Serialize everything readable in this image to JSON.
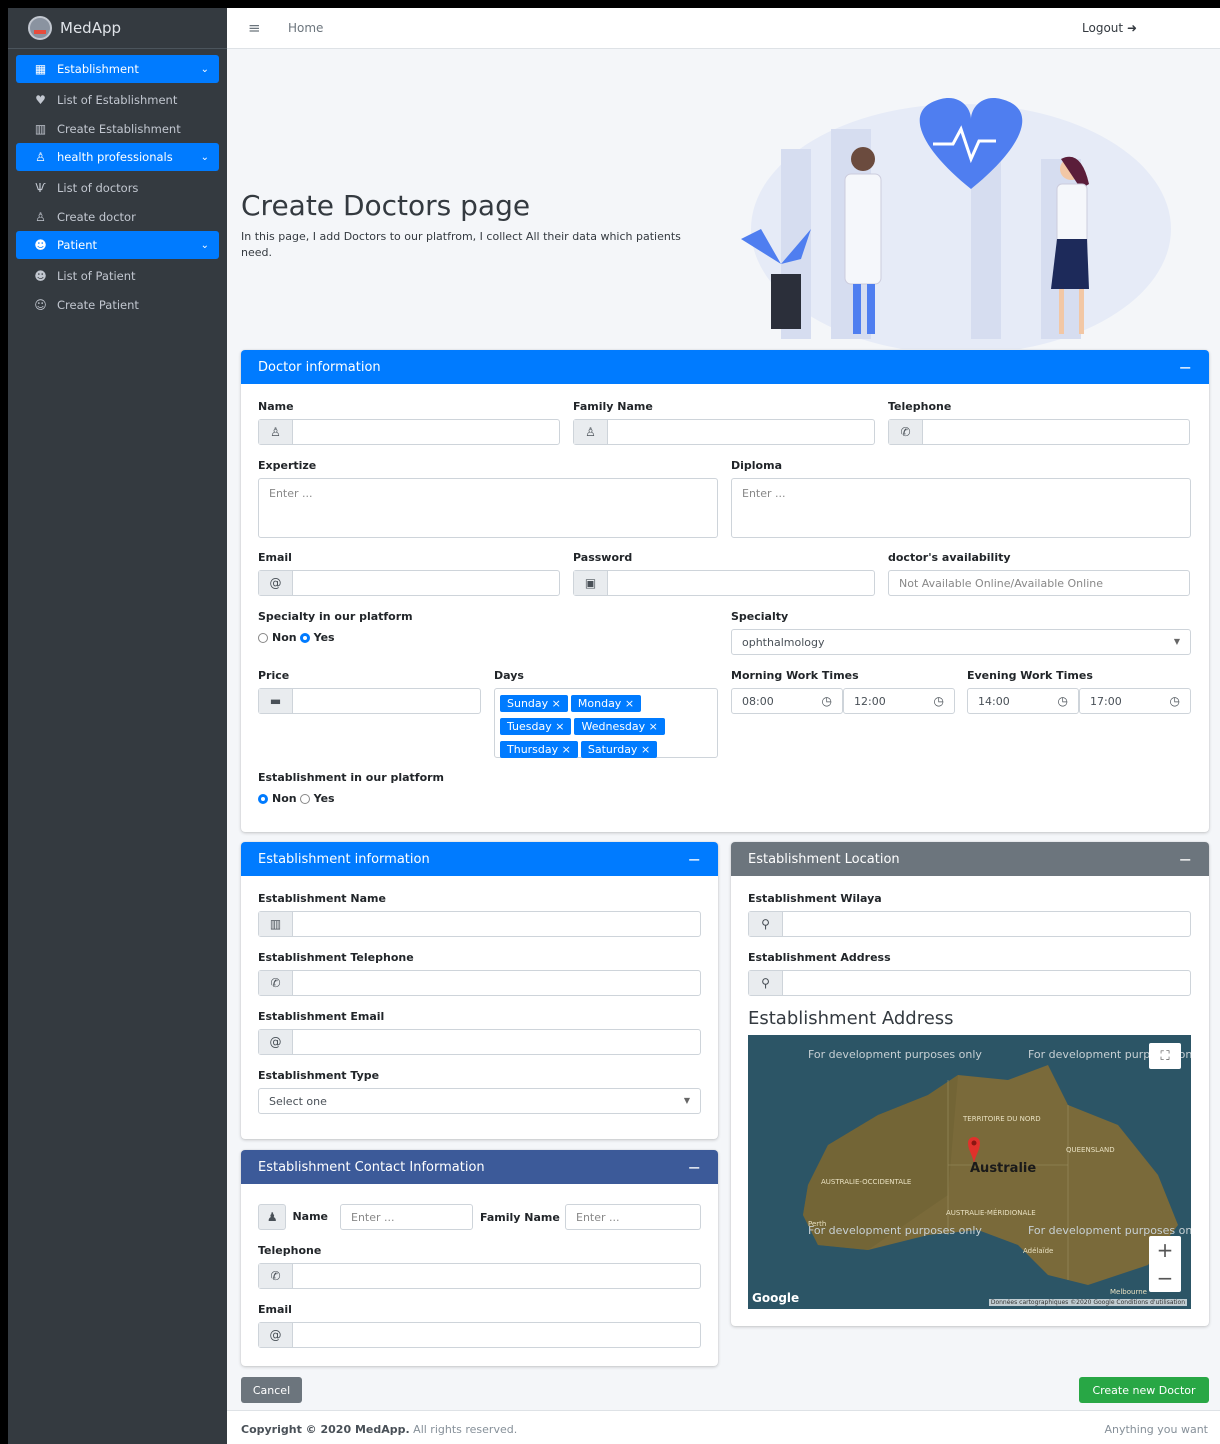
{
  "brand": {
    "name": "MedApp"
  },
  "sidebar": {
    "sections": [
      {
        "title": "Establishment",
        "icon": "hospital-icon",
        "items": [
          {
            "label": "List of Establishment",
            "icon": "heartbeat-icon"
          },
          {
            "label": "Create Establishment",
            "icon": "building-icon"
          }
        ]
      },
      {
        "title": "health professionals",
        "icon": "user-doctor-icon",
        "items": [
          {
            "label": "List of doctors",
            "icon": "stethoscope-icon"
          },
          {
            "label": "Create doctor",
            "icon": "user-doctor-icon"
          }
        ]
      },
      {
        "title": "Patient",
        "icon": "users-icon",
        "items": [
          {
            "label": "List of Patient",
            "icon": "users-icon"
          },
          {
            "label": "Create Patient",
            "icon": "user-plus-icon"
          }
        ]
      }
    ]
  },
  "topbar": {
    "home": "Home",
    "logout": "Logout"
  },
  "hero": {
    "title": "Create Doctors page",
    "subtitle": "In this page, I add Doctors to our platfrom, I collect All their data which patients need."
  },
  "doctor": {
    "header": "Doctor information",
    "name_label": "Name",
    "family_label": "Family Name",
    "telephone_label": "Telephone",
    "expertize_label": "Expertize",
    "expertize_placeholder": "Enter ...",
    "diploma_label": "Diploma",
    "diploma_placeholder": "Enter ...",
    "email_label": "Email",
    "password_label": "Password",
    "availability_label": "doctor's availability",
    "availability_placeholder": "Not Available Online/Available Online",
    "specialty_platform_label": "Specialty in our platform",
    "non": "Non",
    "yes": "Yes",
    "specialty_label": "Specialty",
    "specialty_value": "ophthalmology",
    "price_label": "Price",
    "days_label": "Days",
    "days": [
      "Sunday",
      "Monday",
      "Tuesday",
      "Wednesday",
      "Thursday",
      "Saturday"
    ],
    "morning_label": "Morning Work Times",
    "morning_start": "08:00",
    "morning_end": "12:00",
    "evening_label": "Evening Work Times",
    "evening_start": "14:00",
    "evening_end": "17:00",
    "estab_platform_label": "Establishment in our platform"
  },
  "establishment": {
    "header": "Establishment information",
    "name_label": "Establishment Name",
    "tel_label": "Establishment Telephone",
    "email_label": "Establishment Email",
    "type_label": "Establishment Type",
    "type_value": "Select one"
  },
  "location": {
    "header": "Establishment Location",
    "wilaya_label": "Establishment Wilaya",
    "address_label": "Establishment Address",
    "map_title": "Establishment Address",
    "map_watermark": "For development purposes only",
    "map_labels": [
      "TERRITOIRE DU NORD",
      "QUEENSLAND",
      "Australie",
      "AUSTRALIE-OCCIDENTALE",
      "AUSTRALIE-MÉRIDIONALE",
      "Perth",
      "Adélaïde",
      "Melbourne"
    ],
    "map_credit": "Données cartographiques ©2020 Google   Conditions d'utilisation",
    "google": "Google"
  },
  "contact": {
    "header": "Establishment Contact Information",
    "name_label": "Name",
    "name_placeholder": "Enter ...",
    "family_label": "Family Name",
    "family_placeholder": "Enter ...",
    "tel_label": "Telephone",
    "email_label": "Email"
  },
  "actions": {
    "cancel": "Cancel",
    "create": "Create new Doctor"
  },
  "footer": {
    "copyright": "Copyright © 2020 ",
    "brand": "MedApp.",
    "rights": " All rights reserved.",
    "right": "Anything you want"
  },
  "colors": {
    "primary": "#007bff",
    "secondary": "#6c757d",
    "dark_blue": "#3c5a99",
    "success": "#28a745",
    "sidebar": "#343a40"
  }
}
